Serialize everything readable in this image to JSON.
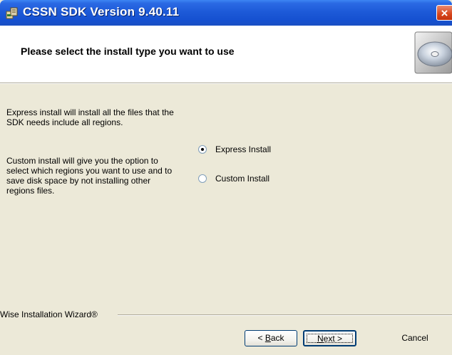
{
  "window": {
    "title": "CSSN SDK Version 9.40.11",
    "close_label": "×"
  },
  "header": {
    "title": "Please select the install type you want to use"
  },
  "descriptions": {
    "express": "Express install will install all the files that the SDK needs include all regions.",
    "custom": "Custom install will give you the option to select which regions you want to use and to save disk space by not installing other regions files."
  },
  "options": [
    {
      "label": "Express Install",
      "selected": true
    },
    {
      "label": "Custom Install",
      "selected": false
    }
  ],
  "footer": {
    "brand": "Wise Installation Wizard®"
  },
  "buttons": {
    "back_prefix": "< ",
    "back_accel": "B",
    "back_rest": "ack",
    "next_accel": "N",
    "next_rest": "ext >",
    "cancel": "Cancel"
  },
  "colors": {
    "titlebar": "#1d5ad8",
    "dialog_bg": "#ece9d8",
    "header_bg": "#ffffff",
    "close": "#d7451b"
  }
}
